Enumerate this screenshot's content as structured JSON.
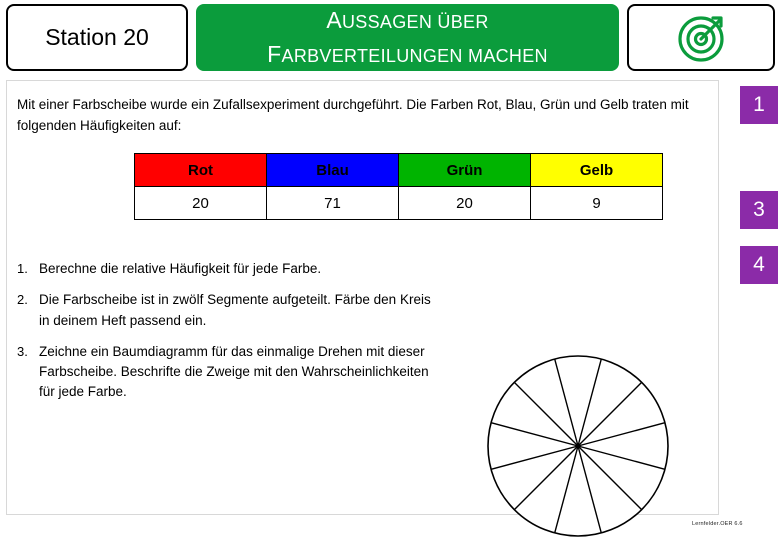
{
  "header": {
    "station_label": "Station 20",
    "title_line_1_cap": "A",
    "title_line_1_rest": "USSAGEN ÜBER",
    "title_line_2_cap": "F",
    "title_line_2_rest": "ARBVERTEILUNGEN MACHEN",
    "logo_icon": "target-dart-icon",
    "title_bg_color": "#0b9c3c"
  },
  "content": {
    "intro": "Mit einer Farbscheibe wurde ein Zufallsexperiment durchgeführt. Die Farben Rot, Blau, Grün und Gelb traten mit folgenden Häufigkeiten auf:",
    "table": {
      "headers": [
        "Rot",
        "Blau",
        "Grün",
        "Gelb"
      ],
      "header_colors": [
        "#ff0000",
        "#0000ff",
        "#00b400",
        "#ffff00"
      ],
      "header_text_colors": [
        "#000000",
        "#000000",
        "#000000",
        "#000000"
      ],
      "values": [
        "20",
        "71",
        "20",
        "9"
      ]
    },
    "tasks": [
      {
        "num": "1.",
        "text": "Berechne die relative Häufigkeit für jede Farbe."
      },
      {
        "num": "2.",
        "text": "Die Farbscheibe ist in zwölf Segmente aufgeteilt. Färbe den Kreis in deinem Heft passend ein."
      },
      {
        "num": "3.",
        "text": "Zeichne ein Baumdiagramm für das einmalige Drehen mit dieser Farbscheibe. Beschrifte die Zweige mit den Wahrscheinlichkeiten für jede Farbe."
      }
    ],
    "wheel": {
      "name": "farbscheibe-wheel",
      "segments": 12
    }
  },
  "badges": [
    {
      "label": "1",
      "color": "#8b2ba8"
    },
    {
      "label": "3",
      "color": "#8b2ba8"
    },
    {
      "label": "4",
      "color": "#8b2ba8"
    }
  ],
  "footer": {
    "credit": "Lernfelder.OER 6.6"
  }
}
